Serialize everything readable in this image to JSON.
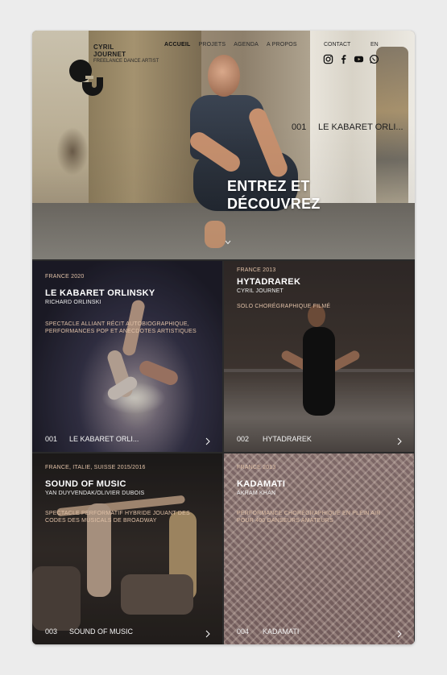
{
  "brand": {
    "line1": "CYRIL",
    "line2": "JOURNET",
    "tagline": "FREELANCE DANCE ARTIST"
  },
  "nav": {
    "items": [
      "ACCUEIL",
      "PROJETS",
      "AGENDA",
      "A PROPOS"
    ],
    "active": "ACCUEIL",
    "contact": "CONTACT",
    "lang": "EN"
  },
  "socials": [
    "instagram-icon",
    "facebook-icon",
    "youtube-icon",
    "whatsapp-icon"
  ],
  "hero": {
    "number": "001",
    "project": "LE KABARET ORLI...",
    "title_line1": "ENTREZ ET",
    "title_line2": "DÉCOUVREZ"
  },
  "projects": [
    {
      "meta": "FRANCE 2020",
      "title": "LE KABARET ORLINSKY",
      "author": "RICHARD ORLINSKI",
      "desc": "SPECTACLE ALLIANT RÉCIT AUTOBIOGRAPHIQUE, PERFORMANCES POP ET ANECDOTES ARTISTIQUES",
      "number": "001",
      "short": "LE KABARET ORLI..."
    },
    {
      "meta": "FRANCE 2013",
      "title": "HYTADRAREK",
      "author": "CYRIL JOURNET",
      "desc": "SOLO CHORÉGRAPHIQUE FILMÉ",
      "number": "002",
      "short": "HYTADRAREK"
    },
    {
      "meta": "FRANCE, ITALIE, SUISSE 2015/2016",
      "title": "SOUND OF MUSIC",
      "author": "YAN DUYVENDAK/OLIVIER DUBOIS",
      "desc": "SPECTACLE PERFORMATIF HYBRIDE JOUANT DES CODES DES MUSICALS DE BROADWAY",
      "number": "003",
      "short": "SOUND OF MUSIC"
    },
    {
      "meta": "FRANCE 2013",
      "title": "KADAMATI",
      "author": "AKRAM KHAN",
      "desc": "PERFORMANCE CHORÉGRAPHIQUE EN PLEIN AIR POUR 400 DANSEURS AMATEURS",
      "number": "004",
      "short": "KADAMATI"
    }
  ],
  "colors": {
    "accent": "#e0c1a7",
    "text_dark": "#1d1d1d",
    "card_bg": "#2a2a2a"
  }
}
